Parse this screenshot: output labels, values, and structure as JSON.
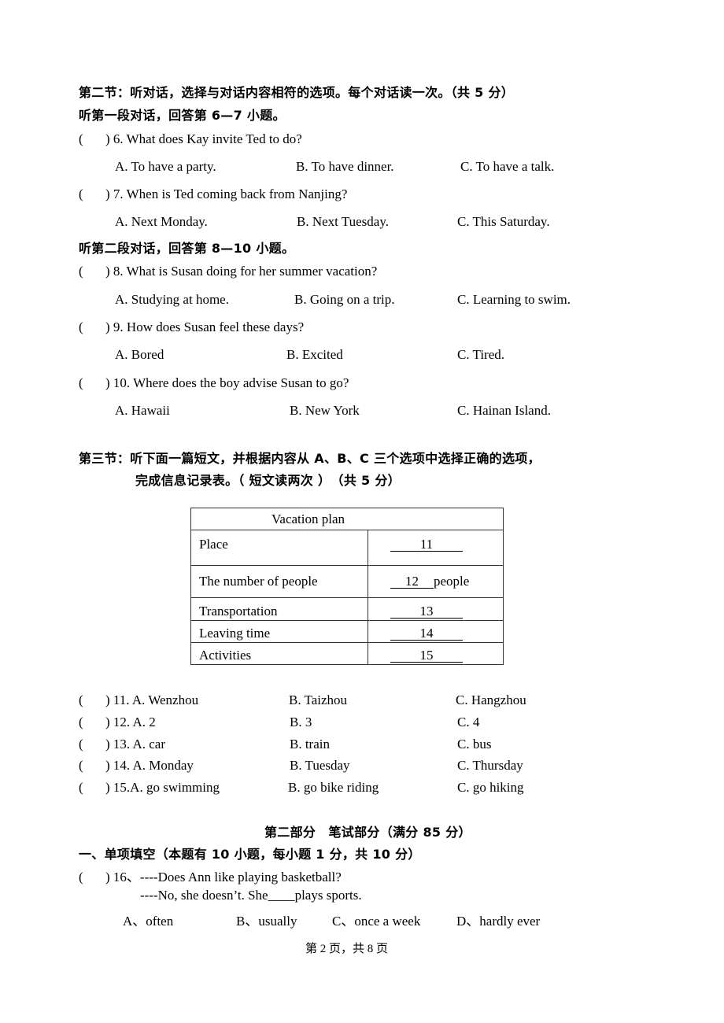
{
  "section2": {
    "heading": "第二节：听对话，选择与对话内容相符的选项。每个对话读一次。（共 5 分）",
    "dialog1_heading": "听第一段对话，回答第 6—7 小题。",
    "dialog2_heading": "听第二段对话，回答第 8—10 小题。",
    "questions": [
      {
        "paren": "(",
        "close": ")",
        "stem": "6. What does Kay invite Ted to do?",
        "options": [
          "A. To have a party.",
          "B. To have dinner.",
          "C. To have a talk."
        ]
      },
      {
        "paren": "(",
        "close": ")",
        "stem": "7. When is Ted coming back from Nanjing?",
        "options": [
          "A. Next Monday.",
          "B. Next Tuesday.",
          "C. This Saturday."
        ]
      },
      {
        "paren": "(",
        "close": ")",
        "stem": "8. What is Susan doing for her summer vacation?",
        "options": [
          "A. Studying at home.",
          "B. Going on a trip.",
          "C. Learning to swim."
        ]
      },
      {
        "paren": "(",
        "close": ")",
        "stem": "9. How does Susan feel these days?",
        "options": [
          "A. Bored",
          "B. Excited",
          "C. Tired."
        ]
      },
      {
        "paren": "(",
        "close": ")",
        "stem": "10. Where does the boy advise Susan to go?",
        "options": [
          "A. Hawaii",
          "B. New York",
          "C. Hainan Island."
        ]
      }
    ]
  },
  "section3": {
    "heading_line1": "第三节：听下面一篇短文，并根据内容从 A、B、C 三个选项中选择正确的选项，",
    "heading_line2": "完成信息记录表。（ 短文读两次 ）　（共 5 分）",
    "table": {
      "title": "Vacation plan",
      "rows": [
        {
          "label": "Place",
          "blank": "11",
          "suffix": ""
        },
        {
          "label": "The number of people",
          "blank": "12",
          "suffix": "people"
        },
        {
          "label": "Transportation",
          "blank": "13",
          "suffix": ""
        },
        {
          "label": "Leaving time",
          "blank": "14",
          "suffix": ""
        },
        {
          "label": "Activities",
          "blank": "15",
          "suffix": ""
        }
      ]
    },
    "questions": [
      {
        "paren": "(",
        "close": ")",
        "a": "11. A. Wenzhou",
        "b": "B. Taizhou",
        "c": "C. Hangzhou"
      },
      {
        "paren": "(",
        "close": ")",
        "a": "12. A. 2",
        "b": "B. 3",
        "c": "C. 4"
      },
      {
        "paren": "(",
        "close": ")",
        "a": "13. A. car",
        "b": "B. train",
        "c": "C. bus"
      },
      {
        "paren": "(",
        "close": ")",
        "a": "14. A. Monday",
        "b": "B. Tuesday",
        "c": "C. Thursday"
      },
      {
        "paren": "(",
        "close": ")",
        "a": "15.A. go swimming",
        "b": "B. go bike riding",
        "c": "C. go hiking"
      }
    ]
  },
  "part2": {
    "heading": "第二部分　笔试部分（满分 85 分）",
    "section1_heading": "一、单项填空（本题有 10 小题，每小题 1 分，共 10 分）",
    "q16": {
      "paren": "(",
      "close": ")",
      "line1": "16、----Does Ann like playing basketball?",
      "line2": "----No, she doesn’t. She____plays sports.",
      "options": [
        "A、often",
        "B、usually",
        "C、once a week",
        "D、hardly ever"
      ]
    }
  },
  "footer": {
    "page_label": "第 2 页，共 8 页"
  }
}
